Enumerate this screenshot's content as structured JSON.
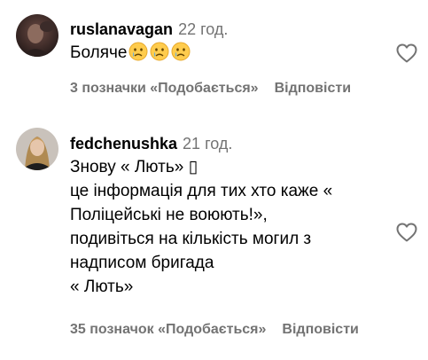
{
  "comments": [
    {
      "username": "ruslanavagan",
      "time": "22 год.",
      "text": "Боляче",
      "emojis": [
        "crying-face",
        "crying-face",
        "crying-face"
      ],
      "likes_label": "3 позначки «Подобається»",
      "reply_label": "Відповісти"
    },
    {
      "username": "fedchenushka",
      "time": "21 год.",
      "text": "Знову « Лють» ▯\nце інформація для тих хто каже « Поліцейські не воюють!»,\nподивіться на кількість могил з надписом бригада\n« Лють»",
      "likes_label": "35 позначок «Подобається»",
      "reply_label": "Відповісти"
    }
  ],
  "colors": {
    "secondary_text": "#737373",
    "emoji_face": "#FFCC4D",
    "emoji_tear": "#5DADEC"
  }
}
